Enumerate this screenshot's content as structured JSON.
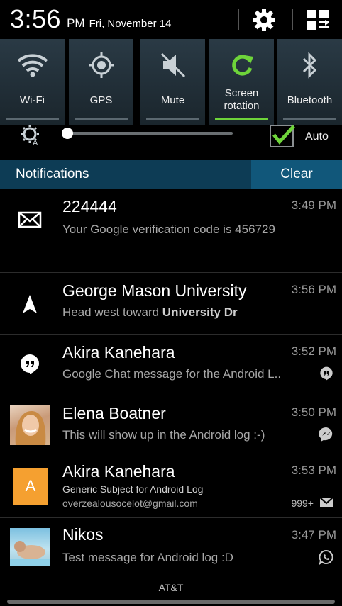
{
  "status": {
    "time": "3:56",
    "ampm": "PM",
    "date": "Fri, November 14"
  },
  "toggles": [
    {
      "label": "Wi-Fi",
      "icon": "wifi-icon",
      "active": false
    },
    {
      "label": "GPS",
      "icon": "gps-icon",
      "active": false
    },
    {
      "label": "Mute",
      "icon": "mute-icon",
      "active": false
    },
    {
      "label": "Screen rotation",
      "icon": "rotation-icon",
      "active": true
    },
    {
      "label": "Bluetooth",
      "icon": "bluetooth-icon",
      "active": false
    }
  ],
  "brightness": {
    "auto_label": "Auto",
    "auto_checked": true,
    "level": 0.0
  },
  "notifications_header": {
    "title": "Notifications",
    "clear_label": "Clear"
  },
  "notifications": [
    {
      "title": "224444",
      "time": "3:49 PM",
      "text": "Your Google verification code is 456729",
      "icon": "email-icon"
    },
    {
      "title": "George Mason University",
      "time": "3:56 PM",
      "text_prefix": "Head west toward ",
      "text_bold": "University Dr",
      "icon": "navigation-icon"
    },
    {
      "title": "Akira Kanehara",
      "time": "3:52 PM",
      "text": "Google Chat message for the Android L..",
      "icon": "hangouts-icon"
    },
    {
      "title": "Elena Boatner",
      "time": "3:50 PM",
      "text": "This will show up in the Android log :-)",
      "icon": "messenger-icon"
    },
    {
      "title": "Akira Kanehara",
      "time": "3:53 PM",
      "subject": "Generic Subject for Android Log",
      "email": "overzealousocelot@gmail.com",
      "count": "999+",
      "avatar_letter": "A",
      "icon": "gmail-icon"
    },
    {
      "title": "Nikos",
      "time": "3:47 PM",
      "text": "Test message for Android log :D",
      "icon": "whatsapp-icon"
    }
  ],
  "carrier": "AT&T",
  "colors": {
    "accent_green": "#6ed43a",
    "header_bg": "#0d3c55",
    "clear_bg": "#11577a",
    "avatar_orange": "#f5a030"
  }
}
